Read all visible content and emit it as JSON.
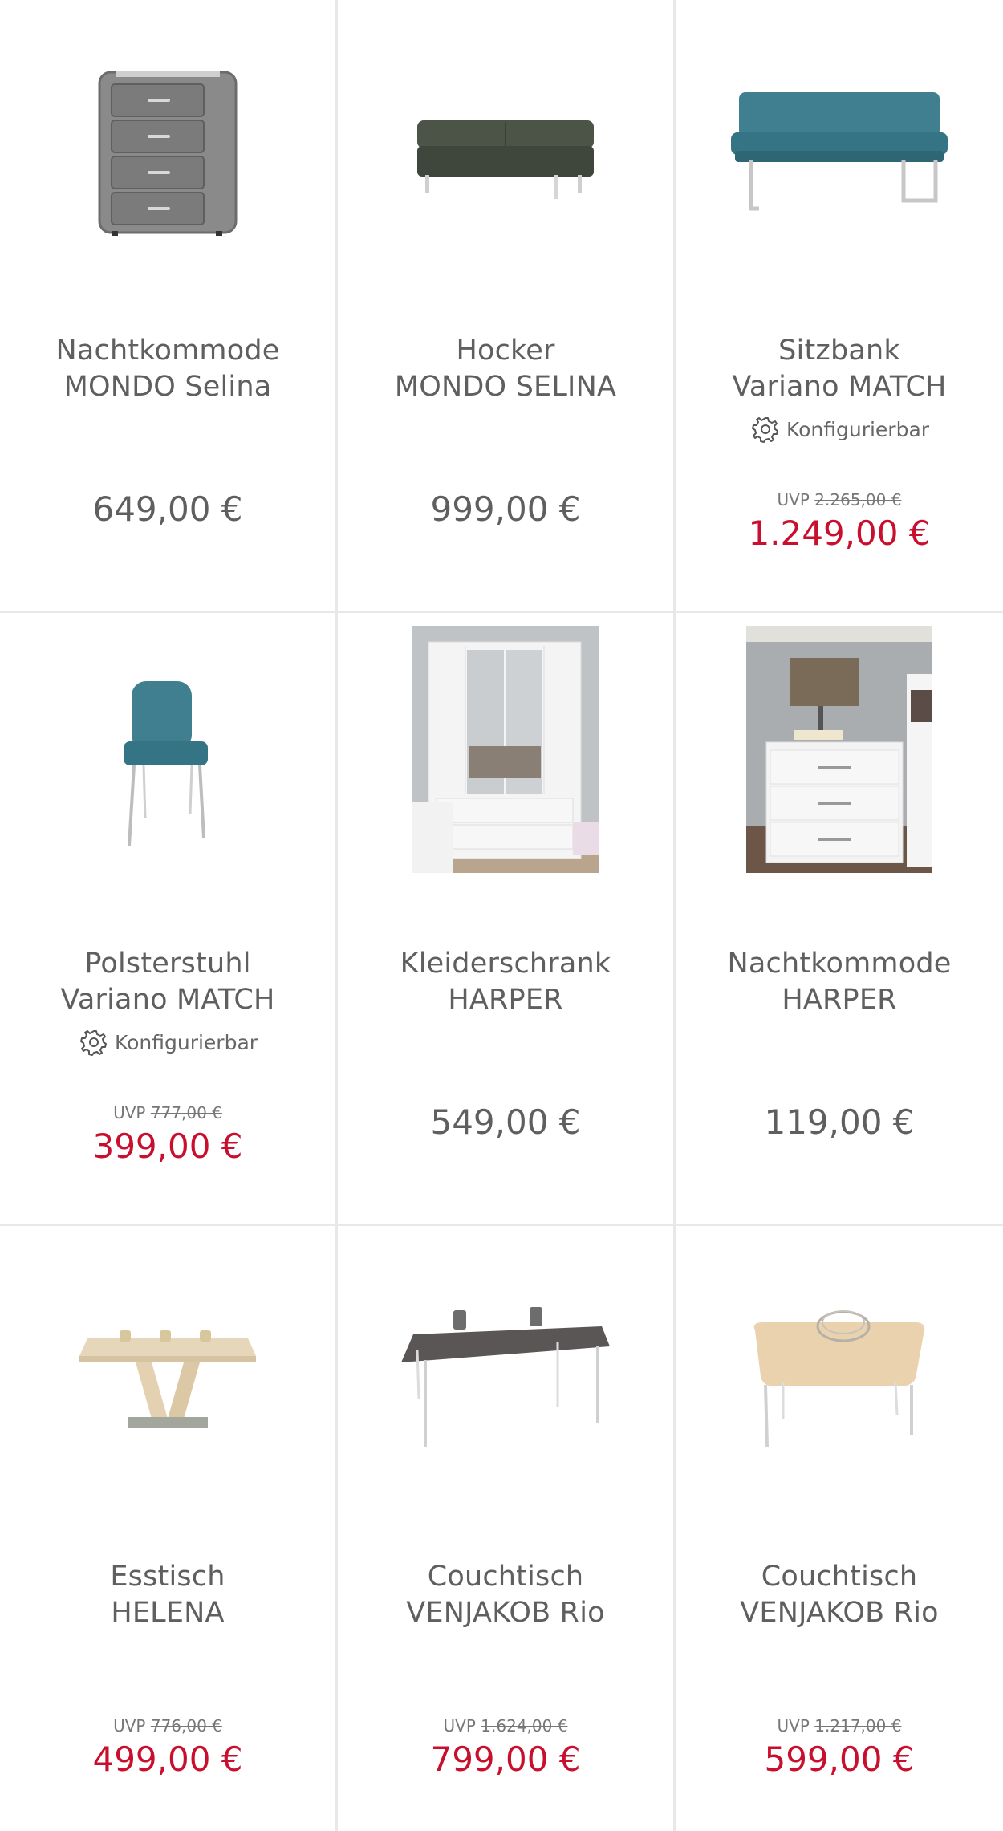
{
  "products": [
    {
      "name_line1": "Nachtkommode",
      "name_line2": "MONDO Selina",
      "configurable": "",
      "uvp_label": "",
      "uvp_price": "",
      "price": "649,00 €",
      "sale": false,
      "image": "grey-upholstered-nightstand"
    },
    {
      "name_line1": "Hocker",
      "name_line2": "MONDO SELINA",
      "configurable": "",
      "uvp_label": "",
      "uvp_price": "",
      "price": "999,00 €",
      "sale": false,
      "image": "dark-green-bench-stool"
    },
    {
      "name_line1": "Sitzbank",
      "name_line2": "Variano MATCH",
      "configurable": "Konfigurierbar",
      "uvp_label": "UVP",
      "uvp_price": "2.265,00 €",
      "price": "1.249,00 €",
      "sale": true,
      "image": "teal-bench"
    },
    {
      "name_line1": "Polsterstuhl",
      "name_line2": "Variano MATCH",
      "configurable": "Konfigurierbar",
      "uvp_label": "UVP",
      "uvp_price": "777,00 €",
      "price": "399,00 €",
      "sale": true,
      "image": "teal-chair"
    },
    {
      "name_line1": "Kleiderschrank",
      "name_line2": "HARPER",
      "configurable": "",
      "uvp_label": "",
      "uvp_price": "",
      "price": "549,00 €",
      "sale": false,
      "image": "white-wardrobe"
    },
    {
      "name_line1": "Nachtkommode",
      "name_line2": "HARPER",
      "configurable": "",
      "uvp_label": "",
      "uvp_price": "",
      "price": "119,00 €",
      "sale": false,
      "image": "white-nightstand"
    },
    {
      "name_line1": "Esstisch",
      "name_line2": "HELENA",
      "configurable": "",
      "uvp_label": "UVP",
      "uvp_price": "776,00 €",
      "price": "499,00 €",
      "sale": true,
      "image": "oak-dining-table"
    },
    {
      "name_line1": "Couchtisch",
      "name_line2": "VENJAKOB Rio",
      "configurable": "",
      "uvp_label": "UVP",
      "uvp_price": "1.624,00 €",
      "price": "799,00 €",
      "sale": true,
      "image": "dark-coffee-table"
    },
    {
      "name_line1": "Couchtisch",
      "name_line2": "VENJAKOB Rio",
      "configurable": "",
      "uvp_label": "UVP",
      "uvp_price": "1.217,00 €",
      "price": "599,00 €",
      "sale": true,
      "image": "oak-coffee-table"
    }
  ],
  "colors": {
    "sale_price": "#c8102e",
    "regular_price": "#5f5f5f",
    "divider": "#e8e8e8"
  }
}
